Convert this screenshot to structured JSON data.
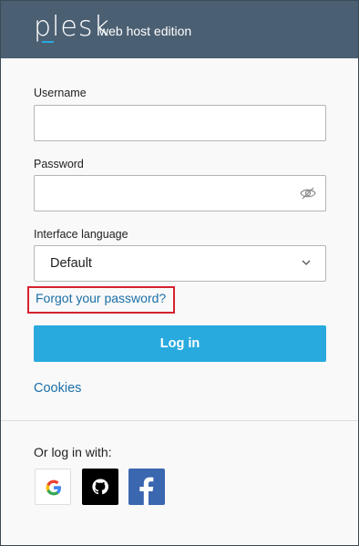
{
  "header": {
    "logo_text": "plesk",
    "edition": "web host edition"
  },
  "form": {
    "username_label": "Username",
    "username_value": "",
    "password_label": "Password",
    "password_value": "",
    "language_label": "Interface language",
    "language_selected": "Default",
    "forgot_link": "Forgot your password?",
    "login_button": "Log in",
    "cookies_link": "Cookies"
  },
  "social": {
    "label": "Or log in with:",
    "providers": [
      {
        "name": "google",
        "icon": "google-icon",
        "color": "#ffffff"
      },
      {
        "name": "github",
        "icon": "github-icon",
        "color": "#000000"
      },
      {
        "name": "facebook",
        "icon": "facebook-icon",
        "color": "#3b66b0"
      }
    ]
  },
  "colors": {
    "header_bg": "#4b5f72",
    "accent": "#28aade",
    "link": "#1a6fa8",
    "highlight_border": "#d6222f"
  }
}
